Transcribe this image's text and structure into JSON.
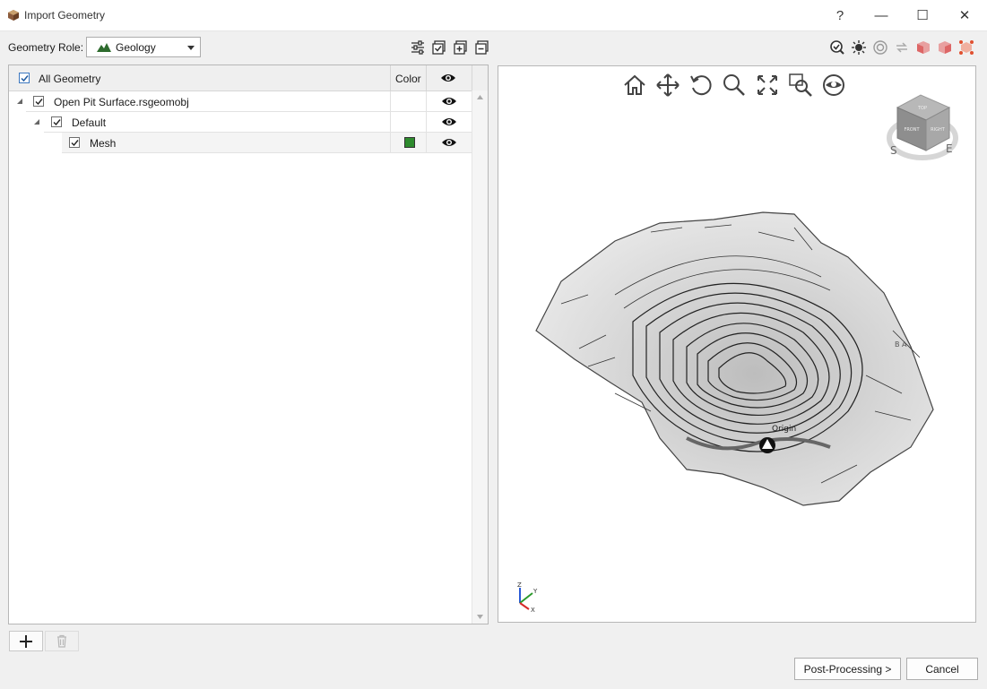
{
  "window": {
    "title": "Import Geometry",
    "help": "?",
    "minimize": "—",
    "maximize": "☐",
    "close": "✕"
  },
  "toolbar": {
    "role_label": "Geometry Role:",
    "role_value": "Geology"
  },
  "tree": {
    "header_label": "All Geometry",
    "color_col": "Color",
    "items": [
      {
        "label": "Open Pit Surface.rsgeomobj"
      },
      {
        "label": "Default"
      },
      {
        "label": "Mesh",
        "color": "#2e8b2e"
      }
    ]
  },
  "viewer": {
    "origin_label": "Origin",
    "compass": [
      "S",
      "E"
    ],
    "cube_faces": [
      "TOP",
      "FRONT",
      "RIGHT"
    ],
    "axis": [
      "Z",
      "Y",
      "X"
    ],
    "annotation": "B A"
  },
  "buttons": {
    "post_processing": "Post-Processing >",
    "cancel": "Cancel"
  }
}
